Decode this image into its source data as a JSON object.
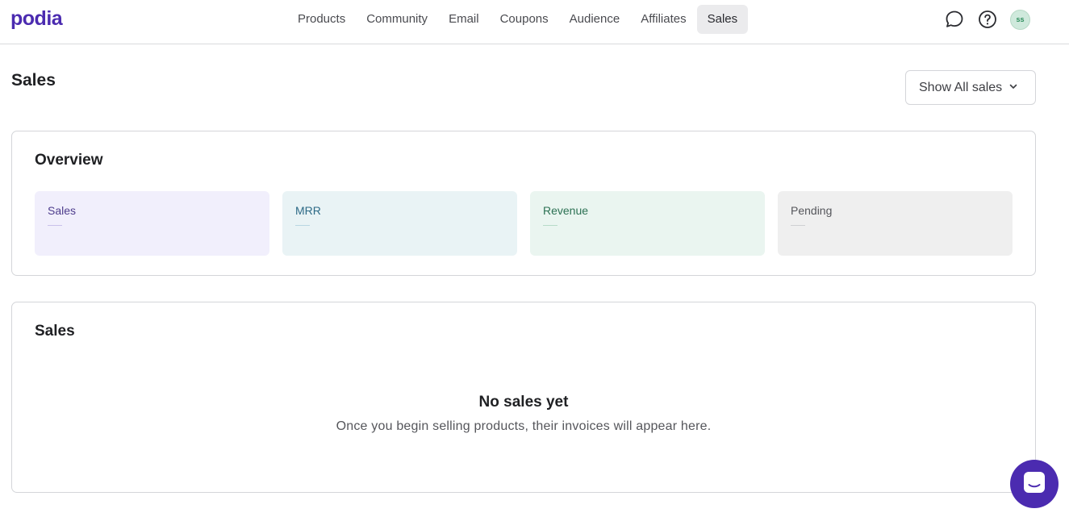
{
  "header": {
    "logo": "podia",
    "nav": [
      {
        "label": "Products",
        "active": false
      },
      {
        "label": "Community",
        "active": false
      },
      {
        "label": "Email",
        "active": false
      },
      {
        "label": "Coupons",
        "active": false
      },
      {
        "label": "Audience",
        "active": false
      },
      {
        "label": "Affiliates",
        "active": false
      },
      {
        "label": "Sales",
        "active": true
      }
    ],
    "icons": [
      "chat-bubble-icon",
      "help-icon"
    ],
    "avatar_initials": "ss"
  },
  "page": {
    "title": "Sales",
    "filter_label": "Show All sales"
  },
  "overview": {
    "title": "Overview",
    "stats": [
      {
        "label": "Sales",
        "value": "—"
      },
      {
        "label": "MRR",
        "value": "—"
      },
      {
        "label": "Revenue",
        "value": "—"
      },
      {
        "label": "Pending",
        "value": "—"
      }
    ]
  },
  "sales_section": {
    "title": "Sales",
    "empty_title": "No sales yet",
    "empty_subtitle": "Once you begin selling products, their invoices will appear here."
  },
  "colors": {
    "brand": "#4b2bb0",
    "sales_tile": "#f1effc",
    "mrr_tile": "#e9f3f5",
    "revenue_tile": "#eaf5f0",
    "pending_tile": "#efefef"
  }
}
